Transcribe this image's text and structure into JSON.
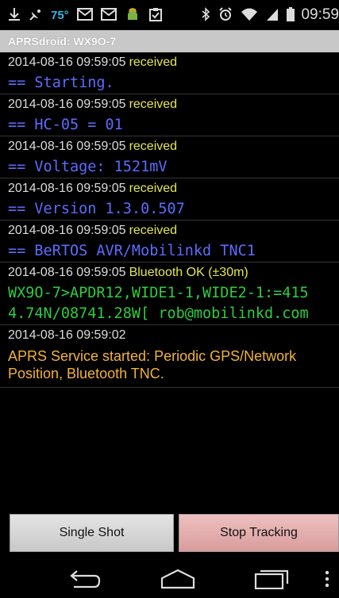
{
  "status_bar": {
    "temperature": "75°",
    "time": "09:59",
    "left_icons": [
      "download-icon",
      "satellite-icon",
      "mail-icon",
      "mail-icon",
      "android-icon",
      "clipboard-check-icon"
    ],
    "right_icons": [
      "bluetooth-icon",
      "alarm-icon",
      "wifi-icon",
      "signal-icon",
      "battery-icon"
    ]
  },
  "app": {
    "title": "APRSdroid: WX9O-7"
  },
  "log": [
    {
      "timestamp": "2014-08-16 09:59:05",
      "type": "received",
      "message": "== Starting."
    },
    {
      "timestamp": "2014-08-16 09:59:05",
      "type": "received",
      "message": "== HC-05 = 01"
    },
    {
      "timestamp": "2014-08-16 09:59:05",
      "type": "received",
      "message": "== Voltage: 1521mV"
    },
    {
      "timestamp": "2014-08-16 09:59:05",
      "type": "received",
      "message": "== Version 1.3.0.507"
    },
    {
      "timestamp": "2014-08-16 09:59:05",
      "type": "received",
      "message": "== BeRTOS AVR/Mobilinkd TNC1"
    },
    {
      "timestamp": "2014-08-16 09:59:05",
      "type": "Bluetooth OK (±30m)",
      "message_line1": "WX9O-7>APDR12,WIDE1-1,WIDE2-1:=415",
      "message_line2": "4.74N/08741.28W[ rob@mobilinkd.com"
    },
    {
      "timestamp": "2014-08-16 09:59:02",
      "type": "",
      "message": "APRS Service started: Periodic GPS/Network Position, Bluetooth TNC."
    }
  ],
  "buttons": {
    "single_shot": "Single Shot",
    "stop_tracking": "Stop Tracking"
  },
  "nav": {
    "icons": [
      "back-icon",
      "home-icon",
      "recent-apps-icon",
      "menu-icon"
    ]
  },
  "colors": {
    "received_text": "#e6e84a",
    "received_message": "#5b6cff",
    "sent_message": "#2ecc40",
    "service_message": "#f2b33a"
  }
}
